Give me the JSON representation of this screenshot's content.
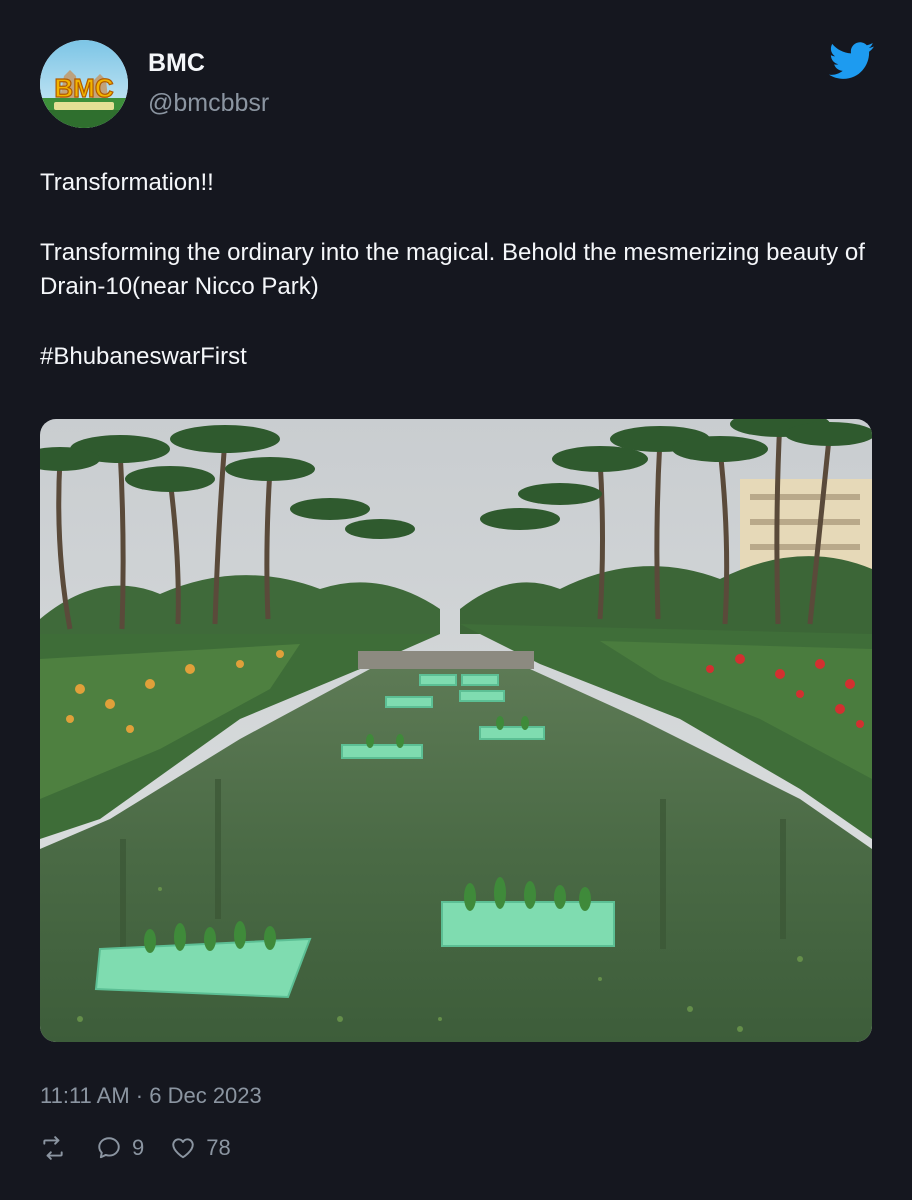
{
  "author": {
    "name": "BMC",
    "handle": "@bmcbbsr",
    "avatar_logo_text": "BMC"
  },
  "tweet": {
    "line1": "Transformation!!",
    "line2": "Transforming the ordinary into the magical. Behold the mesmerizing beauty of Drain-10(near Nicco Park)",
    "hashtag": "#BhubaneswarFirst"
  },
  "meta": {
    "timestamp": "11:11 AM · 6 Dec 2023"
  },
  "actions": {
    "replies": "9",
    "likes": "78"
  },
  "colors": {
    "background": "#15171f",
    "text": "#f5f7fa",
    "muted": "#8b95a1",
    "twitter_blue": "#1d9bf0"
  },
  "icons": [
    "twitter-bird-icon",
    "retweet-icon",
    "reply-icon",
    "like-icon"
  ]
}
